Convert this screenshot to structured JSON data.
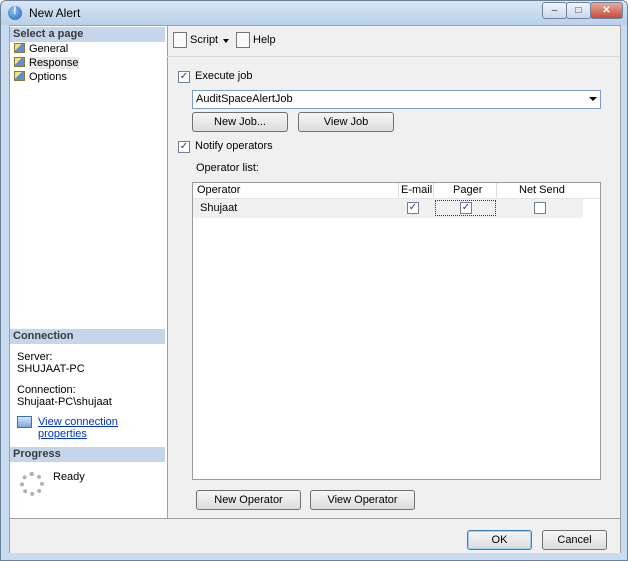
{
  "window": {
    "title": "New Alert",
    "minimize": "–",
    "maximize": "□",
    "close": "✕"
  },
  "left": {
    "select_page_header": "Select a page",
    "pages": [
      {
        "label": "General"
      },
      {
        "label": "Response"
      },
      {
        "label": "Options"
      }
    ],
    "connection_header": "Connection",
    "server_label": "Server:",
    "server_value": "SHUJAAT-PC",
    "connection_label": "Connection:",
    "connection_value": "Shujaat-PC\\shujaat",
    "view_connection_link": "View connection properties",
    "progress_header": "Progress",
    "progress_status": "Ready"
  },
  "toolbar": {
    "script_label": "Script",
    "help_label": "Help"
  },
  "main": {
    "execute_job_label": "Execute job",
    "execute_job_checked": true,
    "job_name": "AuditSpaceAlertJob",
    "new_job_button": "New Job...",
    "view_job_button": "View Job",
    "notify_operators_label": "Notify operators",
    "notify_operators_checked": true,
    "operator_list_label": "Operator list:",
    "columns": [
      "Operator",
      "E-mail",
      "Pager",
      "Net Send"
    ],
    "operators": [
      {
        "name": "Shujaat",
        "email": true,
        "pager": true,
        "net_send": false
      }
    ],
    "new_operator_button": "New Operator",
    "view_operator_button": "View Operator"
  },
  "footer": {
    "ok_button": "OK",
    "cancel_button": "Cancel"
  }
}
